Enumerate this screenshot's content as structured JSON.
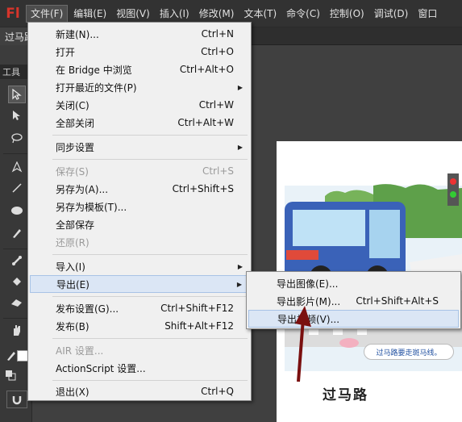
{
  "app": {
    "logo": "Fl",
    "menubar": [
      "文件(F)",
      "编辑(E)",
      "视图(V)",
      "插入(I)",
      "修改(M)",
      "文本(T)",
      "命令(C)",
      "控制(O)",
      "调试(D)",
      "窗口"
    ]
  },
  "document": {
    "tab_title": "过马路"
  },
  "toolbox": {
    "title": "工具"
  },
  "file_menu": {
    "items": [
      {
        "label": "新建(N)...",
        "shortcut": "Ctrl+N"
      },
      {
        "label": "打开",
        "shortcut": "Ctrl+O"
      },
      {
        "label": "在 Bridge 中浏览",
        "shortcut": "Ctrl+Alt+O"
      },
      {
        "label": "打开最近的文件(P)",
        "shortcut": ""
      },
      {
        "label": "关闭(C)",
        "shortcut": "Ctrl+W"
      },
      {
        "label": "全部关闭",
        "shortcut": "Ctrl+Alt+W"
      },
      {
        "label": "同步设置",
        "shortcut": ""
      },
      {
        "label": "保存(S)",
        "shortcut": "Ctrl+S"
      },
      {
        "label": "另存为(A)...",
        "shortcut": "Ctrl+Shift+S"
      },
      {
        "label": "另存为模板(T)...",
        "shortcut": ""
      },
      {
        "label": "全部保存",
        "shortcut": ""
      },
      {
        "label": "还原(R)",
        "shortcut": ""
      },
      {
        "label": "导入(I)",
        "shortcut": ""
      },
      {
        "label": "导出(E)",
        "shortcut": ""
      },
      {
        "label": "发布设置(G)...",
        "shortcut": "Ctrl+Shift+F12"
      },
      {
        "label": "发布(B)",
        "shortcut": "Shift+Alt+F12"
      },
      {
        "label": "AIR 设置...",
        "shortcut": ""
      },
      {
        "label": "ActionScript 设置...",
        "shortcut": ""
      },
      {
        "label": "退出(X)",
        "shortcut": "Ctrl+Q"
      }
    ]
  },
  "export_submenu": {
    "items": [
      {
        "label": "导出图像(E)...",
        "shortcut": ""
      },
      {
        "label": "导出影片(M)...",
        "shortcut": "Ctrl+Shift+Alt+S"
      },
      {
        "label": "导出视频(V)...",
        "shortcut": ""
      }
    ]
  },
  "stage": {
    "caption": "过马路",
    "bubble_text": "过马路要走斑马线。"
  }
}
